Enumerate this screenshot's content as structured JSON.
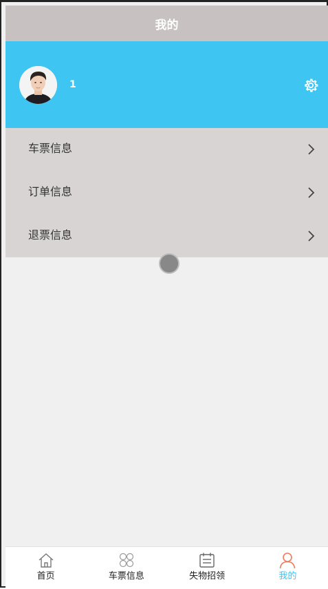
{
  "header": {
    "title": "我的"
  },
  "profile": {
    "username": "1",
    "avatar_icon": "user-photo-avatar",
    "settings_icon": "gear-icon"
  },
  "menu": {
    "items": [
      {
        "label": "车票信息",
        "icon": "chevron-right-icon"
      },
      {
        "label": "订单信息",
        "icon": "chevron-right-icon"
      },
      {
        "label": "退票信息",
        "icon": "chevron-right-icon"
      }
    ]
  },
  "tabbar": {
    "items": [
      {
        "label": "首页",
        "icon": "home-icon",
        "active": false
      },
      {
        "label": "车票信息",
        "icon": "grid-icon",
        "active": false
      },
      {
        "label": "失物招领",
        "icon": "calendar-icon",
        "active": false
      },
      {
        "label": "我的",
        "icon": "user-icon",
        "active": true
      }
    ]
  },
  "colors": {
    "header_bg": "#c7c1c1",
    "profile_bg": "#3fc5f2",
    "menu_bg": "#d8d4d4",
    "page_bg": "#f0f0f0",
    "active_label": "#3fc5f2",
    "active_icon": "#f07a5a"
  }
}
